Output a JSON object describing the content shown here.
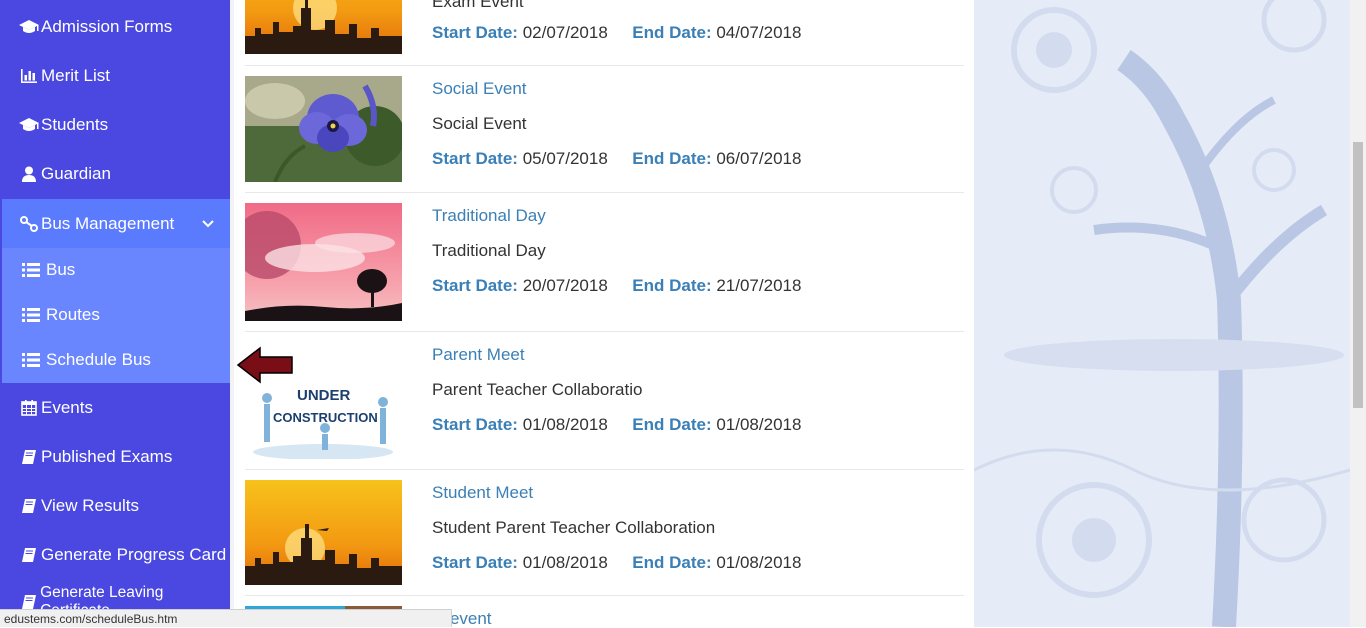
{
  "sidebar": {
    "items": [
      {
        "label": "Admission Forms",
        "icon": "graduation-cap-icon"
      },
      {
        "label": "Merit List",
        "icon": "bar-chart-icon"
      },
      {
        "label": "Students",
        "icon": "graduation-cap-icon"
      },
      {
        "label": "Guardian",
        "icon": "user-icon"
      },
      {
        "label": "Bus Management",
        "icon": "route-icon"
      },
      {
        "label": "Events",
        "icon": "calendar-icon"
      },
      {
        "label": "Published Exams",
        "icon": "book-icon"
      },
      {
        "label": "View Results",
        "icon": "book-icon"
      },
      {
        "label": "Generate Progress Card",
        "icon": "book-icon"
      },
      {
        "label": "Generate Leaving Certificate",
        "icon": "book-icon"
      }
    ],
    "submenu": [
      {
        "label": "Bus",
        "icon": "list-icon"
      },
      {
        "label": "Routes",
        "icon": "list-icon"
      },
      {
        "label": "Schedule Bus",
        "icon": "list-icon"
      }
    ]
  },
  "events": [
    {
      "title": "",
      "desc": "Exam Event",
      "start": "02/07/2018",
      "end": "04/07/2018"
    },
    {
      "title": "Social Event",
      "desc": "Social Event",
      "start": "05/07/2018",
      "end": "06/07/2018"
    },
    {
      "title": "Traditional Day",
      "desc": "Traditional Day",
      "start": "20/07/2018",
      "end": "21/07/2018"
    },
    {
      "title": "Parent Meet",
      "desc": "Parent Teacher Collaboratio",
      "start": "01/08/2018",
      "end": "01/08/2018"
    },
    {
      "title": "Student Meet",
      "desc": "Student Parent Teacher Collaboration",
      "start": "01/08/2018",
      "end": "01/08/2018"
    },
    {
      "title": "st event",
      "desc": "",
      "start": "",
      "end": ""
    }
  ],
  "labels": {
    "start_date": "Start Date:",
    "end_date": "End Date:"
  },
  "thumb_text": {
    "under": "UNDER",
    "construction": "CONSTRUCTION"
  },
  "status_url": "edustems.com/scheduleBus.htm",
  "colors": {
    "sidebar": "#4a48e0",
    "submenu": "#6a86ff",
    "link": "#3a7fb6",
    "arrow": "#7a0e16"
  }
}
